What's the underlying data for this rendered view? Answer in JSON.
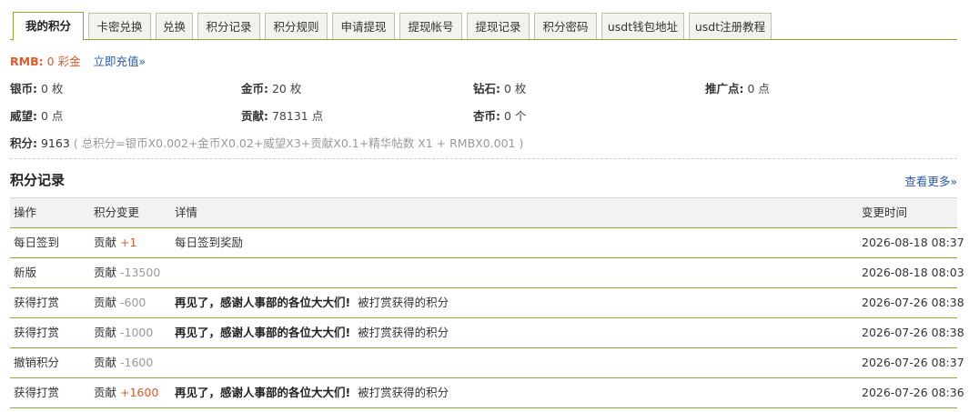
{
  "tabs": [
    {
      "label": "我的积分",
      "active": true
    },
    {
      "label": "卡密兑换"
    },
    {
      "label": "兑换"
    },
    {
      "label": "积分记录"
    },
    {
      "label": "积分规则"
    },
    {
      "label": "申请提现"
    },
    {
      "label": "提现帐号"
    },
    {
      "label": "提现记录"
    },
    {
      "label": "积分密码"
    },
    {
      "label": "usdt钱包地址"
    },
    {
      "label": "usdt注册教程"
    }
  ],
  "rmb": {
    "label": "RMB:",
    "value": "0 彩金",
    "recharge_link": "立即充值»"
  },
  "stats": {
    "silver": {
      "label": "银币:",
      "value": "0 枚"
    },
    "gold": {
      "label": "金币:",
      "value": "20 枚"
    },
    "diamond": {
      "label": "钻石:",
      "value": "0 枚"
    },
    "promo": {
      "label": "推广点:",
      "value": "0 点"
    },
    "prestige": {
      "label": "威望:",
      "value": "0 点"
    },
    "contribution": {
      "label": "贡献:",
      "value": "78131 点"
    },
    "apricot": {
      "label": "杏币:",
      "value": "0 个"
    }
  },
  "total": {
    "label": "积分:",
    "value": "9163",
    "formula": "( 总积分=银币X0.002+金币X0.02+威望X3+贡献X0.1+精华帖数 X1 + RMBX0.001 )"
  },
  "records": {
    "title": "积分记录",
    "more_link": "查看更多»",
    "headers": {
      "op": "操作",
      "change": "积分变更",
      "detail": "详情",
      "time": "变更时间"
    },
    "rows": [
      {
        "op": "每日签到",
        "type": "贡献",
        "amount": "+1",
        "sign": "pos",
        "detail_bold": "",
        "detail": "每日签到奖励",
        "time": "2026-08-18 08:37"
      },
      {
        "op": "新版",
        "type": "贡献",
        "amount": "-13500",
        "sign": "neg",
        "detail_bold": "",
        "detail": "",
        "time": "2026-08-18 08:03"
      },
      {
        "op": "获得打赏",
        "type": "贡献",
        "amount": "-600",
        "sign": "neg",
        "detail_bold": "再见了，感谢人事部的各位大大们!",
        "detail": "被打赏获得的积分",
        "time": "2026-07-26 08:38"
      },
      {
        "op": "获得打赏",
        "type": "贡献",
        "amount": "-1000",
        "sign": "neg",
        "detail_bold": "再见了，感谢人事部的各位大大们!",
        "detail": "被打赏获得的积分",
        "time": "2026-07-26 08:38"
      },
      {
        "op": "撤销积分",
        "type": "贡献",
        "amount": "-1600",
        "sign": "neg",
        "detail_bold": "",
        "detail": "",
        "time": "2026-07-26 08:37"
      },
      {
        "op": "获得打赏",
        "type": "贡献",
        "amount": "+1600",
        "sign": "pos",
        "detail_bold": "再见了，感谢人事部的各位大大们!",
        "detail": "被打赏获得的积分",
        "time": "2026-07-26 08:36"
      }
    ]
  },
  "colors": {
    "accent_green": "#8aaa36",
    "highlight_orange": "#e05a2a",
    "link_blue": "#2b5aa8"
  }
}
